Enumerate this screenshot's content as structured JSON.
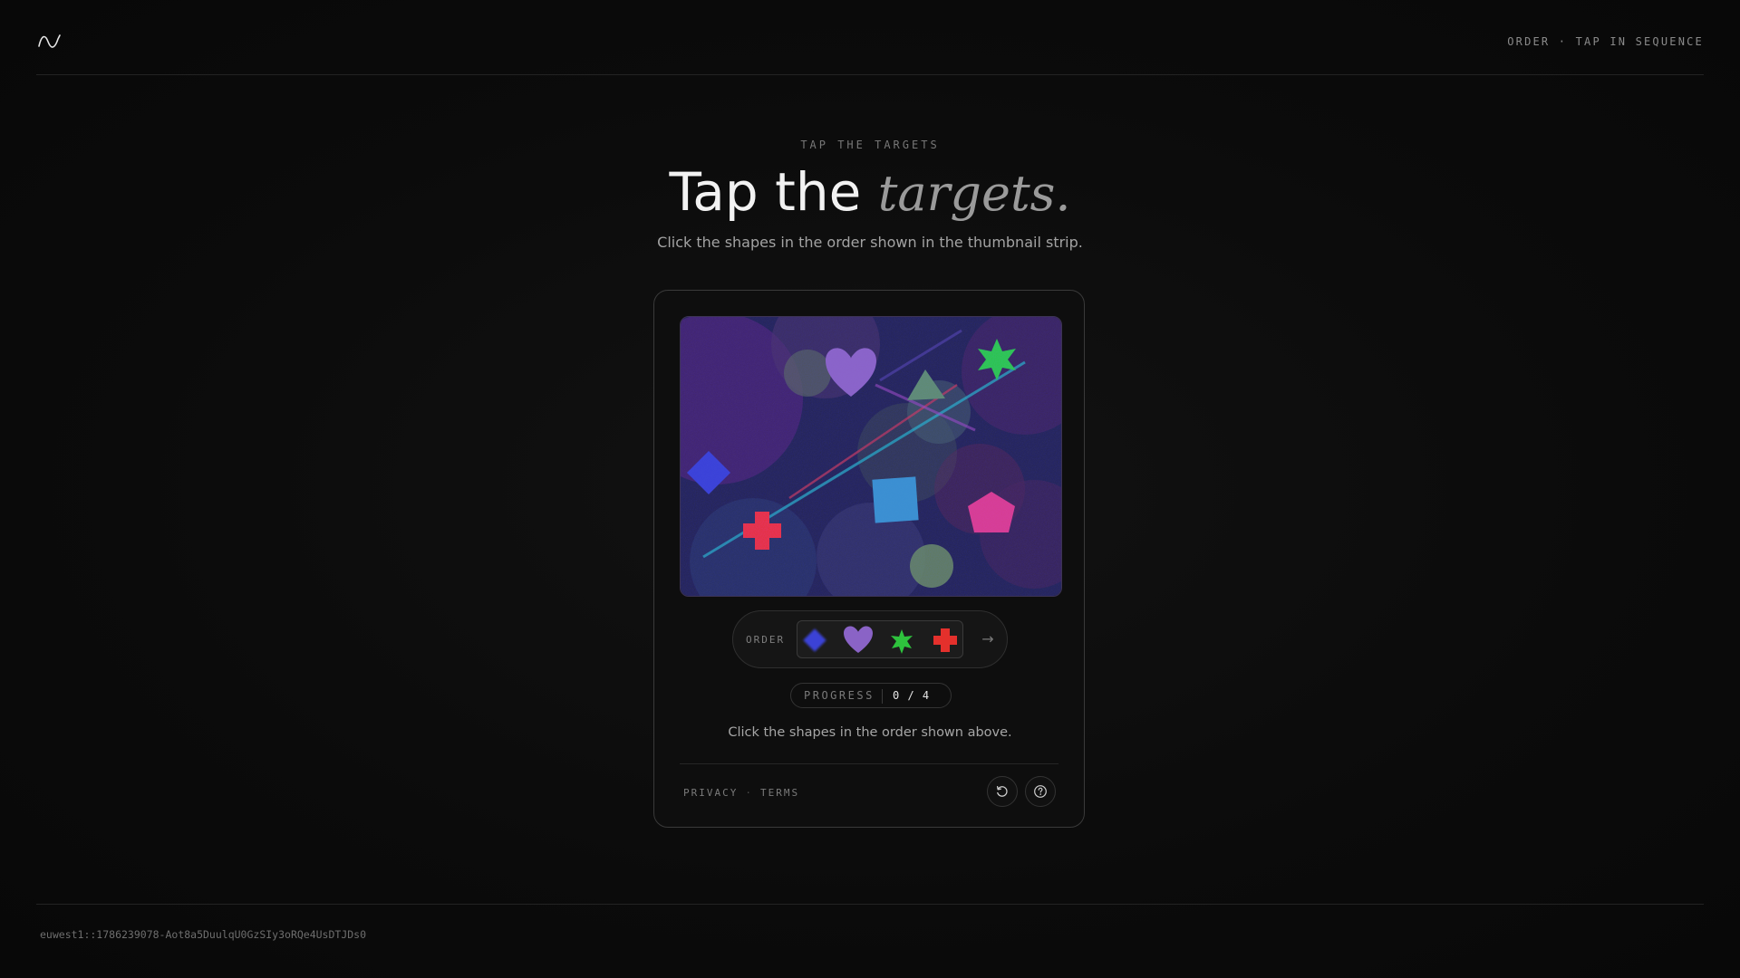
{
  "header": {
    "mode_label": "ORDER · TAP IN SEQUENCE"
  },
  "hero": {
    "eyebrow": "TAP THE TARGETS",
    "title_plain": "Tap the ",
    "title_emphasis": "targets.",
    "subtitle": "Click the shapes in the order shown in the thumbnail strip."
  },
  "challenge": {
    "order_label": "ORDER",
    "order_sequence": [
      "blue-diamond",
      "purple-heart",
      "green-star",
      "red-cross"
    ],
    "next_arrow": "→",
    "progress_label": "PROGRESS",
    "progress_current": 0,
    "progress_total": 4,
    "progress_text": "0 / 4",
    "instruction": "Click the shapes in the order shown above.",
    "shapes": [
      "blue-diamond",
      "purple-heart",
      "green-triangle",
      "green-star",
      "cyan-square",
      "pink-pentagon",
      "red-cross",
      "green-circle"
    ],
    "colors": {
      "blue": "#3a43d6",
      "purple": "#8a63c6",
      "green": "#2ec23d",
      "red": "#e4302c",
      "cyan": "#3b8fcf",
      "pink": "#d63d8e"
    }
  },
  "footer_links": {
    "privacy": "PRIVACY",
    "separator": "·",
    "terms": "TERMS"
  },
  "icons": {
    "refresh": "refresh-icon",
    "help": "help-icon"
  },
  "session_id": "euwest1::1786239078-Aot8a5DuulqU0GzSIy3oRQe4UsDTJDs0"
}
